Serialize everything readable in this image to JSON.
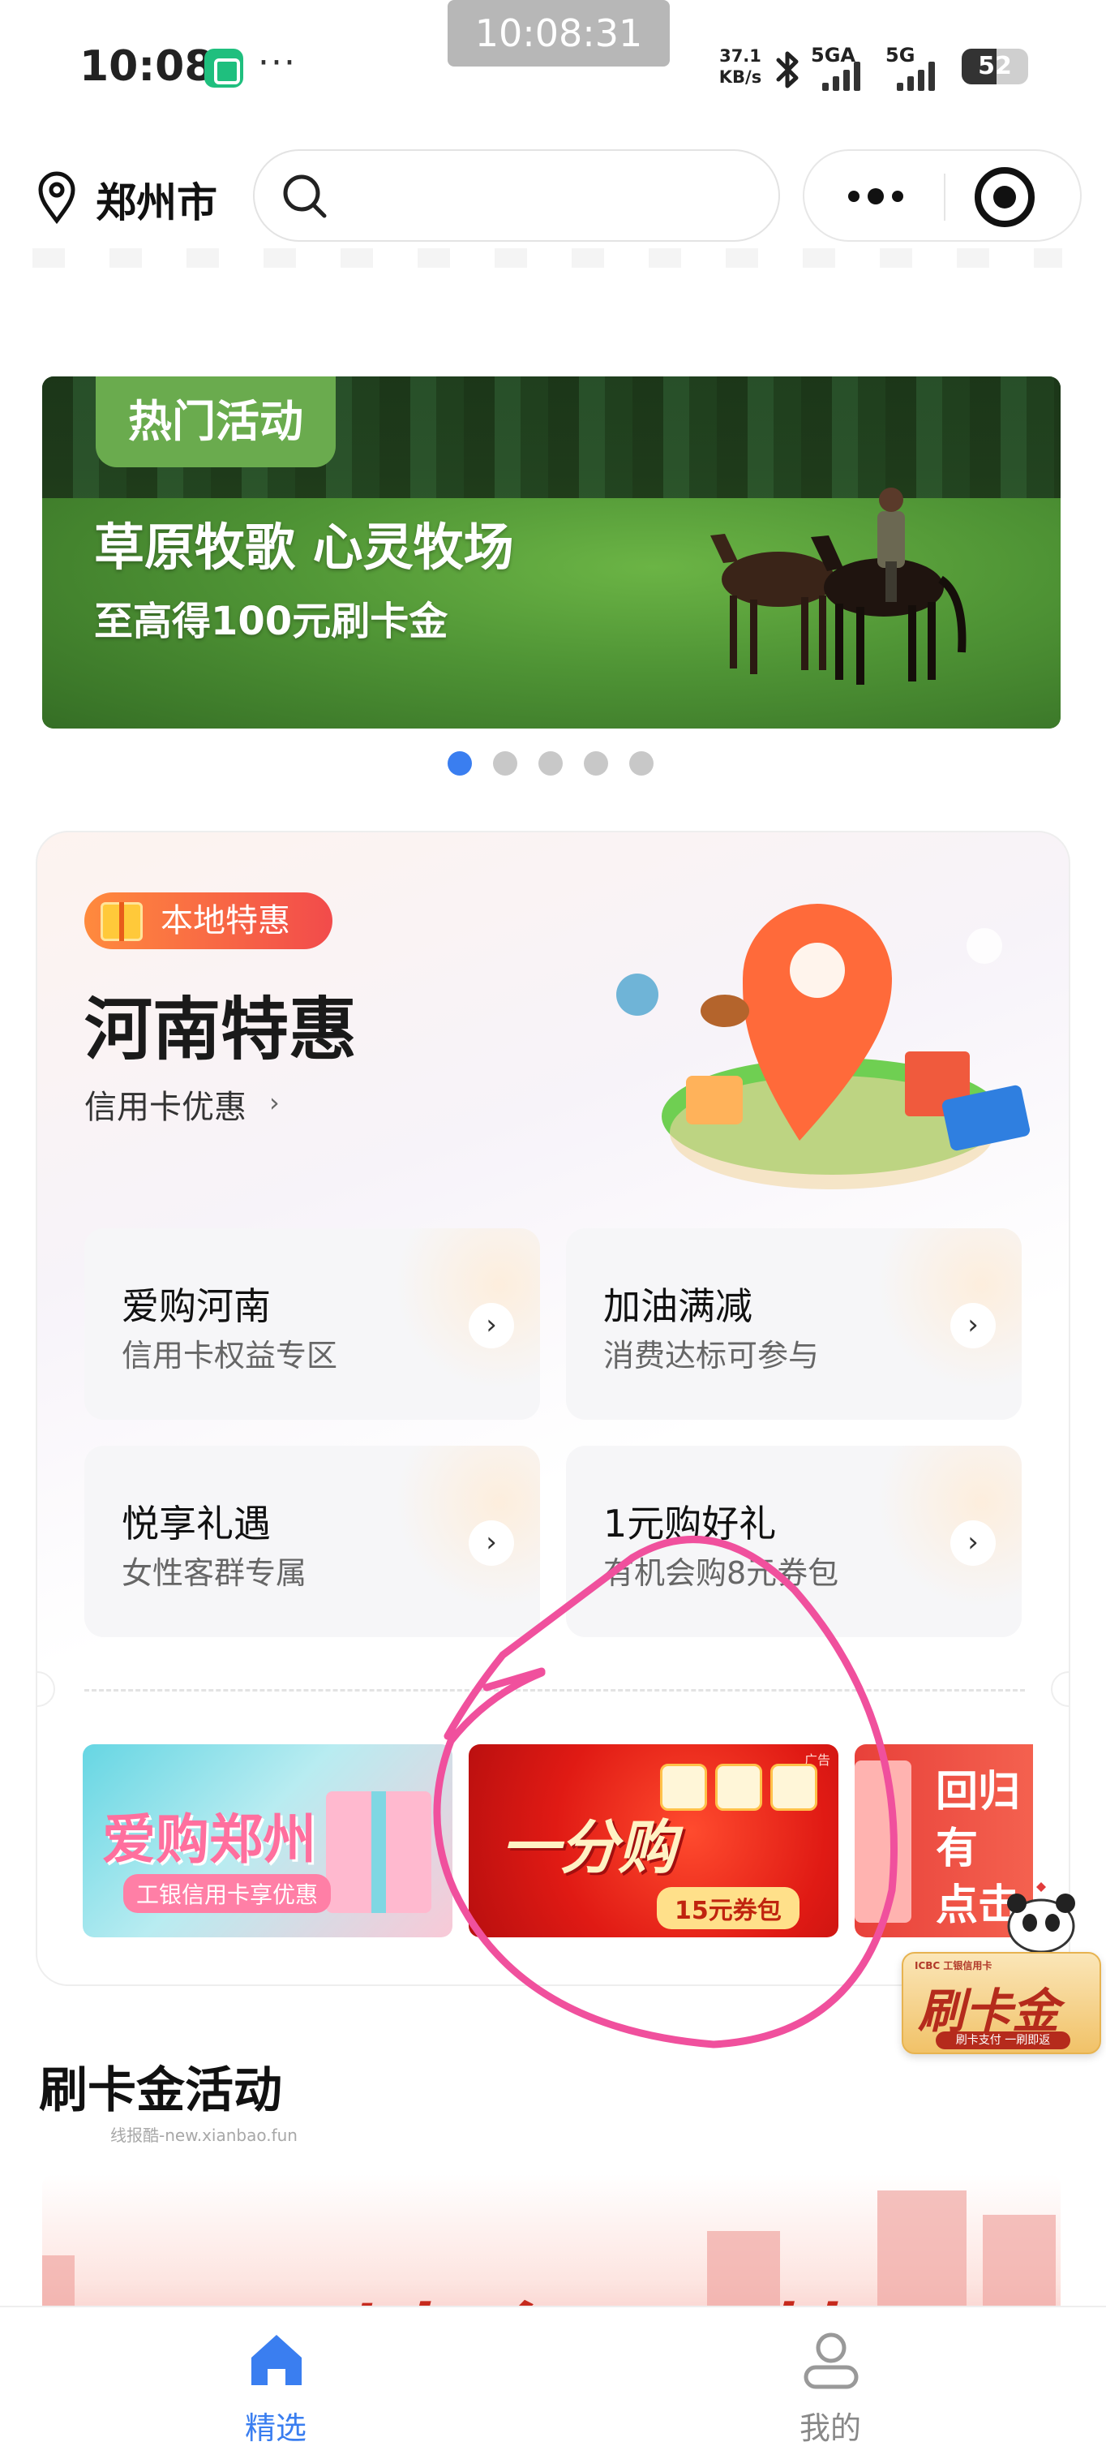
{
  "status_bar": {
    "time": "10:08",
    "more": "···",
    "clock_overlay": "10:08:31",
    "net_speed_value": "37.1",
    "net_speed_unit": "KB/s",
    "sim1_label": "5GA",
    "sim2_label": "5G",
    "battery_level": 52,
    "battery_text": "52"
  },
  "header": {
    "city": "郑州市",
    "search_placeholder": ""
  },
  "banner": {
    "tag": "热门活动",
    "title": "草原牧歌 心灵牧场",
    "subtitle": "至高得100元刷卡金",
    "dots_count": 5,
    "active_dot": 0
  },
  "henan": {
    "tag": "本地特惠",
    "title": "河南特惠",
    "link": "信用卡优惠",
    "link_chevron": "›",
    "benefits": [
      {
        "title": "爱购河南",
        "subtitle": "信用卡权益专区"
      },
      {
        "title": "加油满减",
        "subtitle": "消费达标可参与"
      },
      {
        "title": "悦享礼遇",
        "subtitle": "女性客群专属"
      },
      {
        "title": "1元购好礼",
        "subtitle": "有机会购8元券包"
      }
    ],
    "arrow": "›",
    "promos": {
      "zz_title": "爱购郑州",
      "zz_sub": "工银信用卡享优惠",
      "fen_title": "一分购",
      "fen_coupon": "15元券包",
      "fen_ad": "广告",
      "third_text": "回归有 点击"
    }
  },
  "float_card": {
    "brand": "ICBC 工银信用卡",
    "title": "刷卡金",
    "sub": "刷卡支付 一刷即返"
  },
  "section": {
    "title": "刷卡金活动",
    "watermark": "线报酷-new.xianbao.fun",
    "banner_text": "刷卡金天天抽"
  },
  "tabs": [
    {
      "label": "精选",
      "active": true
    },
    {
      "label": "我的",
      "active": false
    }
  ],
  "colors": {
    "accent_blue": "#3a7ef0",
    "tag_green": "#6aab4e",
    "local_tag_start": "#ff8a3d",
    "local_tag_end": "#f24b4b"
  }
}
